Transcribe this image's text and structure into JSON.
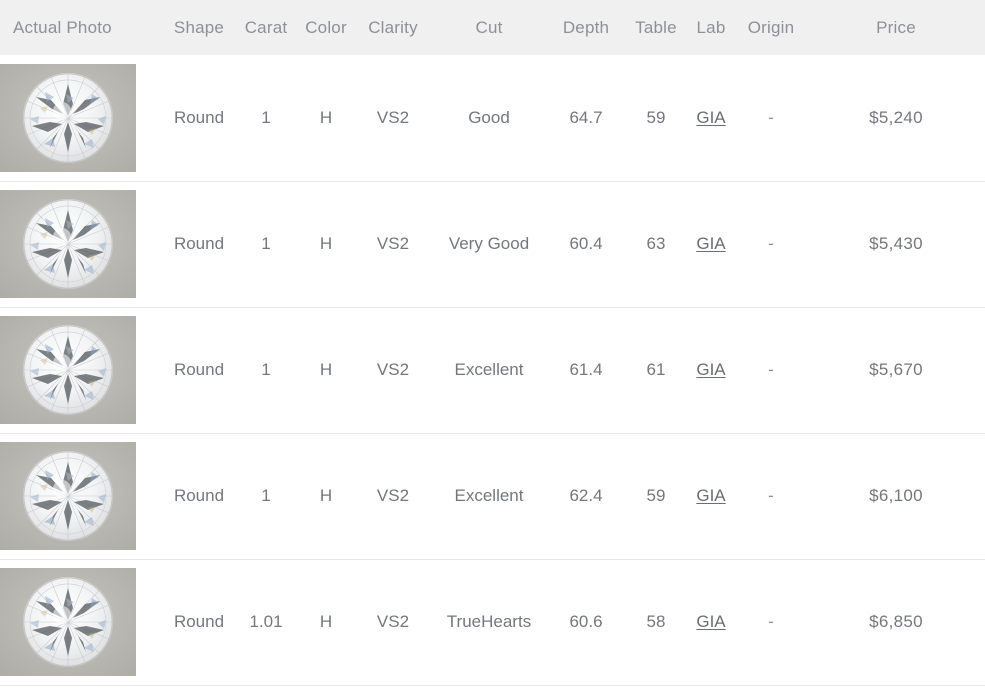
{
  "table": {
    "columns": [
      {
        "key": "photo",
        "label": "Actual Photo",
        "align": "left"
      },
      {
        "key": "shape",
        "label": "Shape",
        "align": "center"
      },
      {
        "key": "carat",
        "label": "Carat",
        "align": "center"
      },
      {
        "key": "color",
        "label": "Color",
        "align": "center"
      },
      {
        "key": "clarity",
        "label": "Clarity",
        "align": "center"
      },
      {
        "key": "cut",
        "label": "Cut",
        "align": "center"
      },
      {
        "key": "depth",
        "label": "Depth",
        "align": "center"
      },
      {
        "key": "table",
        "label": "Table",
        "align": "center"
      },
      {
        "key": "lab",
        "label": "Lab",
        "align": "center"
      },
      {
        "key": "origin",
        "label": "Origin",
        "align": "center"
      },
      {
        "key": "price",
        "label": "Price",
        "align": "center"
      }
    ],
    "rows": [
      {
        "photo_alt": "round-brilliant-diamond-photo",
        "shape": "Round",
        "carat": "1",
        "color": "H",
        "clarity": "VS2",
        "cut": "Good",
        "depth": "64.7",
        "table": "59",
        "lab": "GIA",
        "origin": "-",
        "price": "$5,240"
      },
      {
        "photo_alt": "round-brilliant-diamond-photo",
        "shape": "Round",
        "carat": "1",
        "color": "H",
        "clarity": "VS2",
        "cut": "Very Good",
        "depth": "60.4",
        "table": "63",
        "lab": "GIA",
        "origin": "-",
        "price": "$5,430"
      },
      {
        "photo_alt": "round-brilliant-diamond-photo",
        "shape": "Round",
        "carat": "1",
        "color": "H",
        "clarity": "VS2",
        "cut": "Excellent",
        "depth": "61.4",
        "table": "61",
        "lab": "GIA",
        "origin": "-",
        "price": "$5,670"
      },
      {
        "photo_alt": "round-brilliant-diamond-photo",
        "shape": "Round",
        "carat": "1",
        "color": "H",
        "clarity": "VS2",
        "cut": "Excellent",
        "depth": "62.4",
        "table": "59",
        "lab": "GIA",
        "origin": "-",
        "price": "$6,100"
      },
      {
        "photo_alt": "round-brilliant-diamond-photo",
        "shape": "Round",
        "carat": "1.01",
        "color": "H",
        "clarity": "VS2",
        "cut": "TrueHearts",
        "depth": "60.6",
        "table": "58",
        "lab": "GIA",
        "origin": "-",
        "price": "$6,850"
      }
    ]
  },
  "colors": {
    "header_background": "#f0f0f0",
    "header_text": "#8d9096",
    "body_text": "#74777c",
    "price_text": "#5f6367",
    "row_divider": "#e9e9e9",
    "photo_background": "#b9b7b2",
    "page_background": "#ffffff"
  }
}
